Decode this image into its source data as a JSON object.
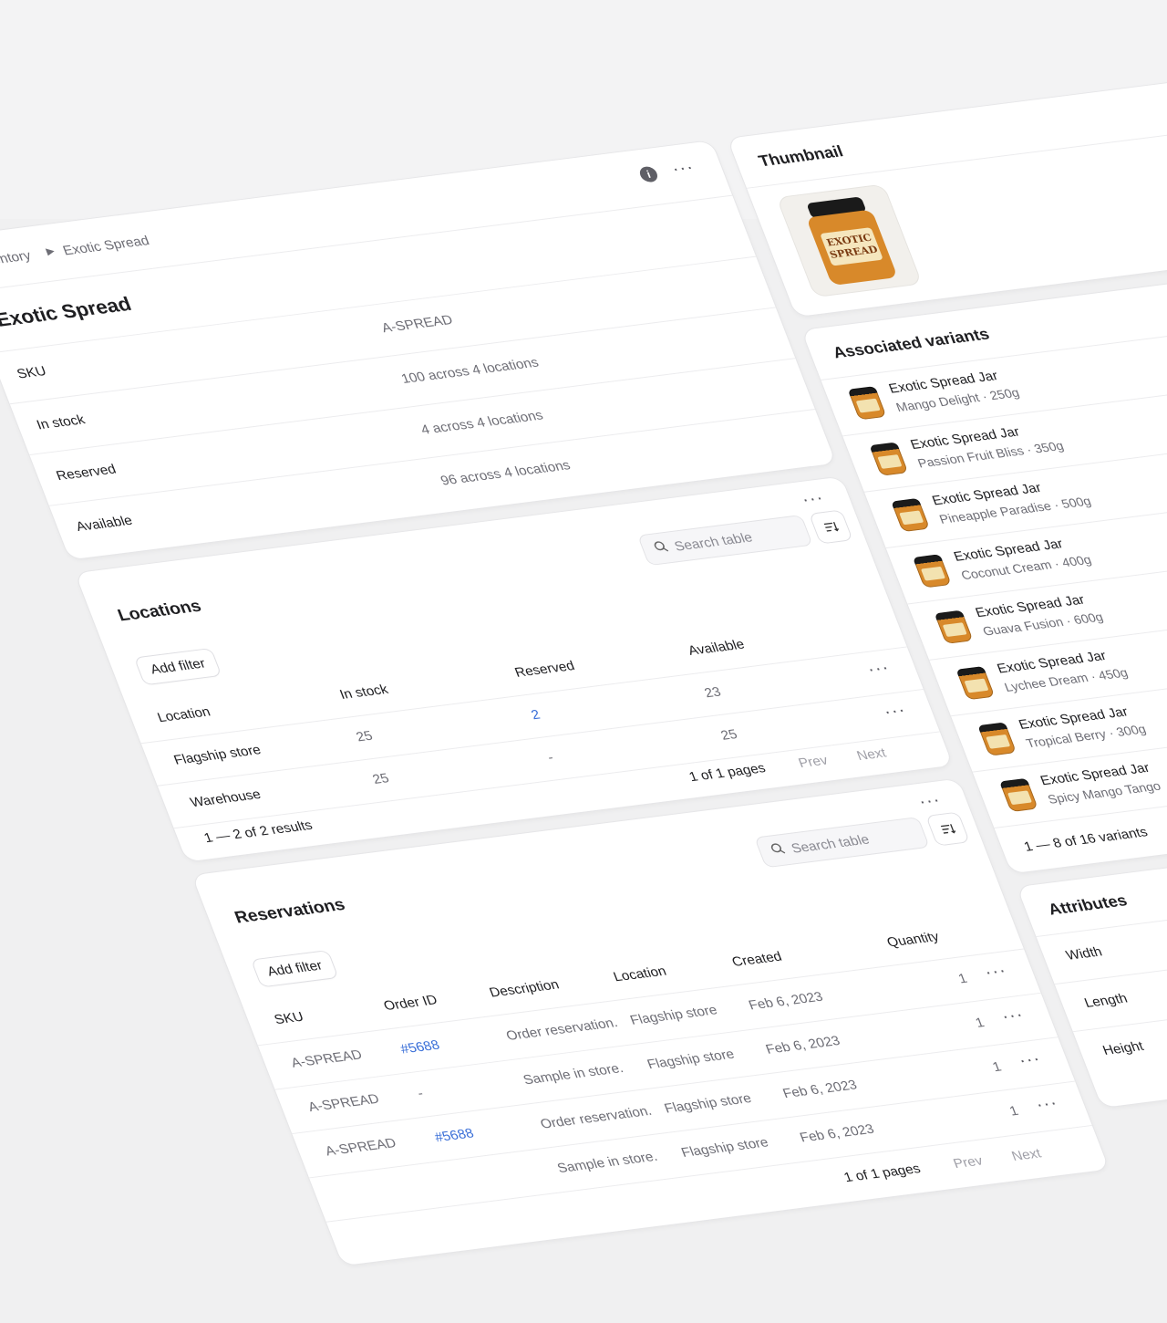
{
  "breadcrumb": {
    "parent": "Inventory",
    "current": "Exotic Spread"
  },
  "item": {
    "title": "Exotic Spread",
    "fields": [
      {
        "label": "SKU",
        "value": "A-SPREAD"
      },
      {
        "label": "In stock",
        "value": "100 across 4 locations"
      },
      {
        "label": "Reserved",
        "value": "4 across 4 locations"
      },
      {
        "label": "Available",
        "value": "96 across 4 locations"
      }
    ]
  },
  "locations": {
    "title": "Locations",
    "search_placeholder": "Search table",
    "add_filter": "Add filter",
    "columns": [
      "Location",
      "In stock",
      "Reserved",
      "Available"
    ],
    "rows": [
      {
        "location": "Flagship store",
        "in_stock": "25",
        "reserved": "2",
        "available": "23"
      },
      {
        "location": "Warehouse",
        "in_stock": "25",
        "reserved": "-",
        "available": "25"
      }
    ],
    "results": "1 — 2 of 2 results",
    "pages": "1 of 1 pages",
    "prev": "Prev",
    "next": "Next"
  },
  "reservations": {
    "title": "Reservations",
    "search_placeholder": "Search table",
    "add_filter": "Add filter",
    "columns": [
      "SKU",
      "Order ID",
      "Description",
      "Location",
      "Created",
      "Quantity"
    ],
    "rows": [
      {
        "sku": "A-SPREAD",
        "order_id": "#5688",
        "description": "Order reservation.",
        "location": "Flagship store",
        "created": "Feb 6, 2023",
        "quantity": "1"
      },
      {
        "sku": "A-SPREAD",
        "order_id": "-",
        "description": "Sample in store.",
        "location": "Flagship store",
        "created": "Feb 6, 2023",
        "quantity": "1"
      },
      {
        "sku": "A-SPREAD",
        "order_id": "#5688",
        "description": "Order reservation.",
        "location": "Flagship store",
        "created": "Feb 6, 2023",
        "quantity": "1"
      },
      {
        "sku": "",
        "order_id": "",
        "description": "Sample in store.",
        "location": "Flagship store",
        "created": "Feb 6, 2023",
        "quantity": "1"
      }
    ],
    "pages": "1 of 1 pages",
    "prev": "Prev",
    "next": "Next"
  },
  "thumbnail": {
    "title": "Thumbnail",
    "jar_label_line1": "EXOTIC",
    "jar_label_line2": "SPREAD"
  },
  "variants": {
    "title": "Associated variants",
    "items": [
      {
        "name": "Exotic Spread Jar",
        "detail": "Mango Delight · 250g"
      },
      {
        "name": "Exotic Spread Jar",
        "detail": "Passion Fruit Bliss · 350g"
      },
      {
        "name": "Exotic Spread Jar",
        "detail": "Pineapple Paradise · 500g"
      },
      {
        "name": "Exotic Spread Jar",
        "detail": "Coconut Cream · 400g"
      },
      {
        "name": "Exotic Spread Jar",
        "detail": "Guava Fusion · 600g"
      },
      {
        "name": "Exotic Spread Jar",
        "detail": "Lychee Dream · 450g"
      },
      {
        "name": "Exotic Spread Jar",
        "detail": "Tropical Berry · 300g"
      },
      {
        "name": "Exotic Spread Jar",
        "detail": "Spicy Mango Tango"
      }
    ],
    "summary": "1 — 8 of 16 variants"
  },
  "attributes": {
    "title": "Attributes",
    "items": [
      "Width",
      "Length",
      "Height"
    ]
  },
  "colors": {
    "link": "#3a6fd8",
    "jar_orange": "#d8892a"
  }
}
